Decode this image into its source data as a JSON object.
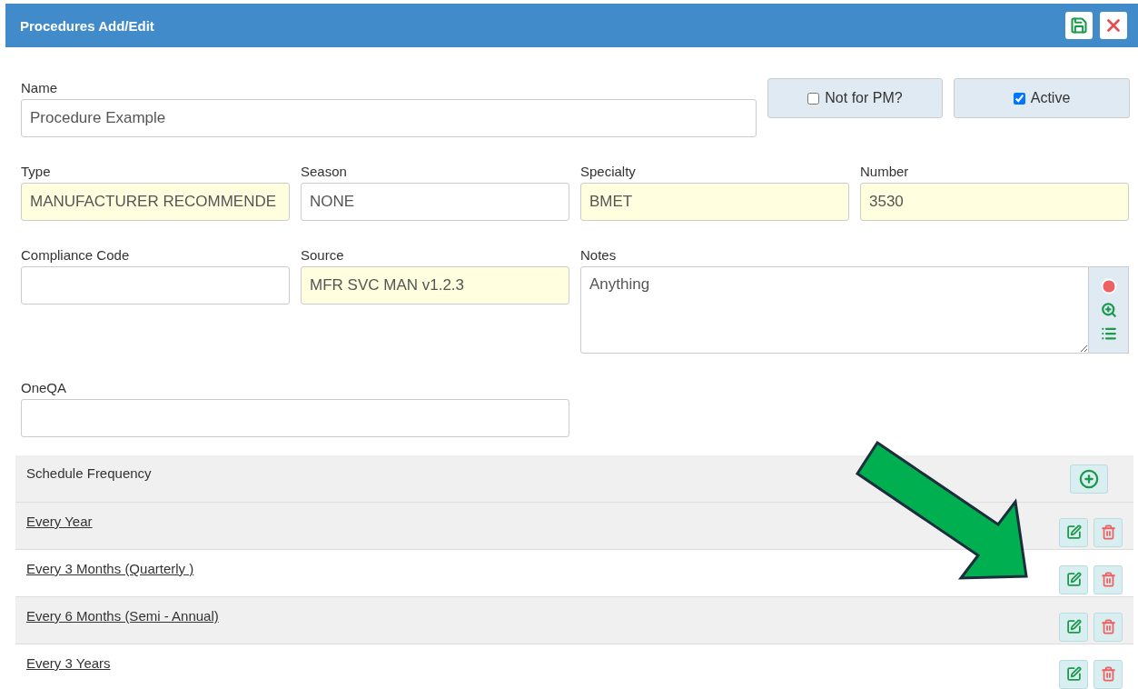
{
  "window": {
    "title": "Procedures Add/Edit"
  },
  "name_field": {
    "label": "Name",
    "value": "Procedure Example",
    "highlighted": false
  },
  "toggles": [
    {
      "label": "Not for PM?",
      "checked": false
    },
    {
      "label": "Active",
      "checked": true
    }
  ],
  "fields": [
    {
      "label": "Type",
      "value": "MANUFACTURER RECOMMENDE",
      "highlighted": true
    },
    {
      "label": "Season",
      "value": "NONE",
      "highlighted": false
    },
    {
      "label": "Specialty",
      "value": "BMET",
      "highlighted": true
    },
    {
      "label": "Number",
      "value": "3530",
      "highlighted": true
    },
    {
      "label": "Compliance Code",
      "highlighted": false
    },
    {
      "label": "Source",
      "value": "MFR SVC MAN v1.2.3",
      "highlighted": true
    }
  ],
  "notes": {
    "label": "Notes",
    "value": "Anything"
  },
  "oneqa": {
    "label": "OneQA"
  },
  "schedule": {
    "title": "Schedule Frequency",
    "rows": [
      {
        "label": "Every Year"
      },
      {
        "label": "Every 3 Months (Quarterly )"
      },
      {
        "label": "Every 6 Months (Semi - Annual)"
      },
      {
        "label": "Every 3 Years"
      }
    ]
  }
}
